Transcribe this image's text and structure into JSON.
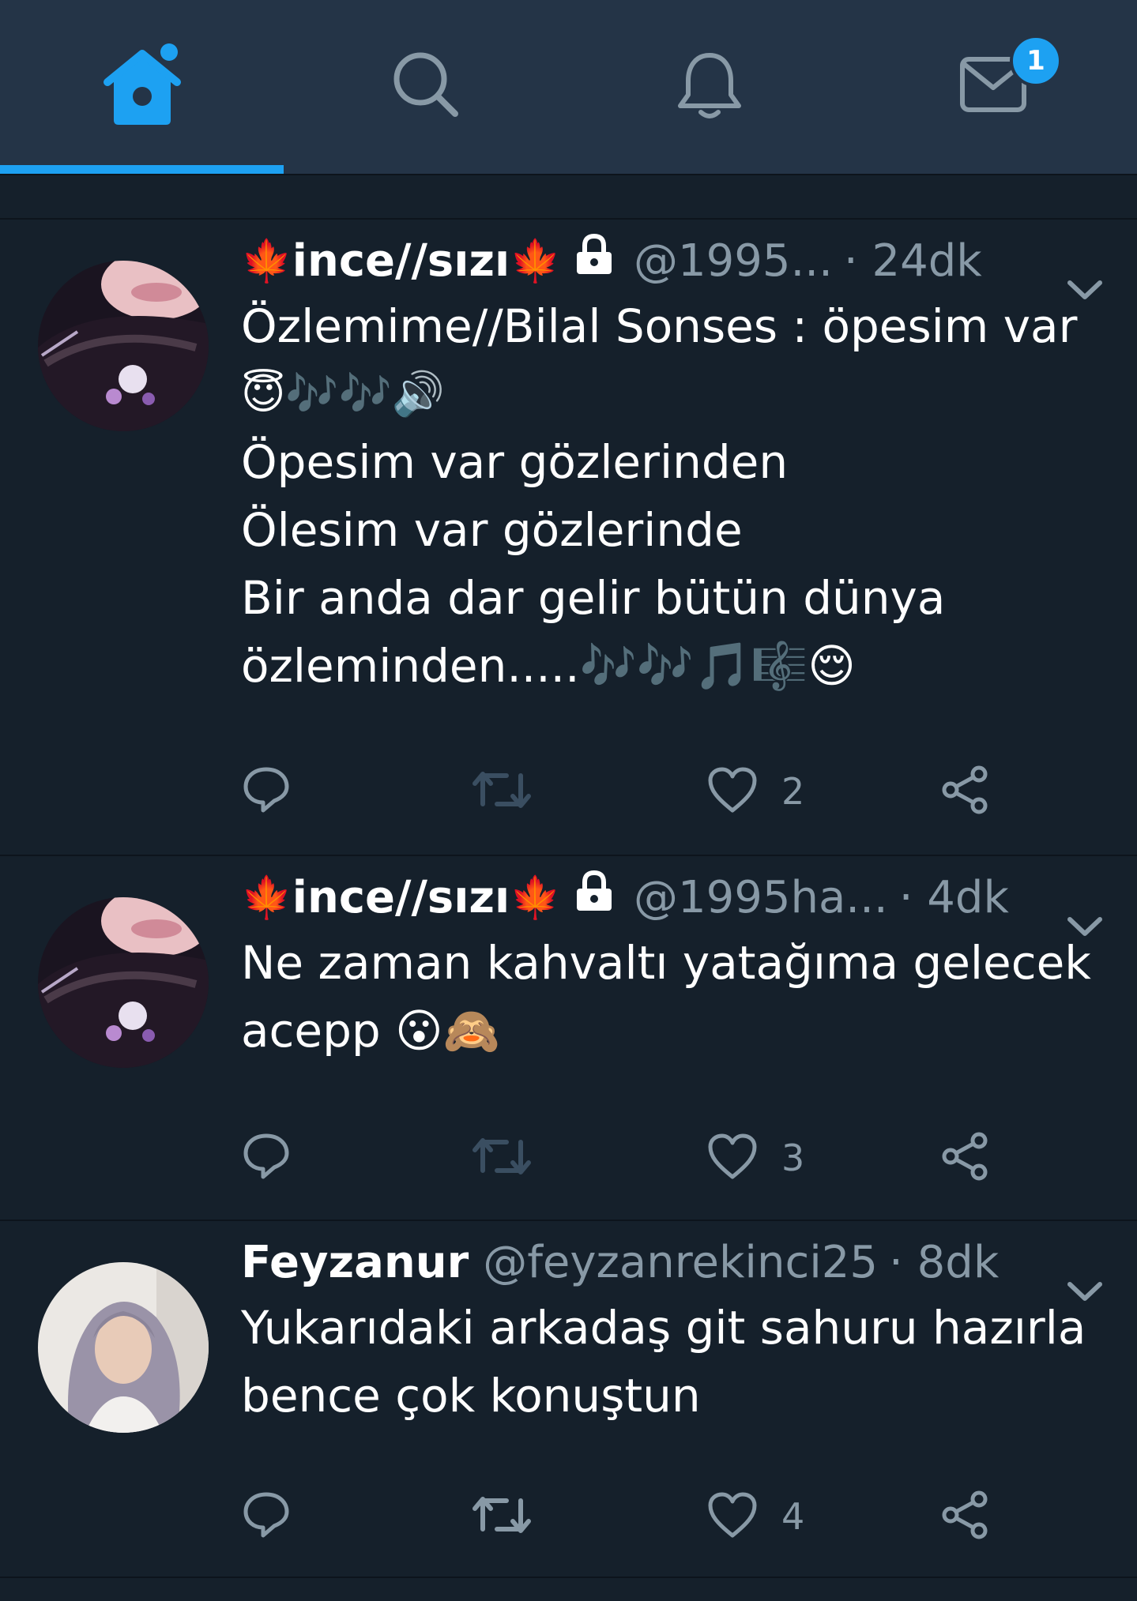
{
  "nav": {
    "tabs": [
      {
        "name": "home",
        "icon": "home-icon",
        "active": true
      },
      {
        "name": "search",
        "icon": "search-icon",
        "active": false
      },
      {
        "name": "notifications",
        "icon": "bell-icon",
        "active": false
      },
      {
        "name": "messages",
        "icon": "mail-icon",
        "active": false
      }
    ],
    "messages_badge": "1"
  },
  "colors": {
    "background": "#15202b",
    "topbar": "#243447",
    "accent": "#1da1f2",
    "secondary_text": "#8899a6"
  },
  "tweets": [
    {
      "leaf_left": "🍁",
      "name": "ince//sızı",
      "leaf_right": "🍁",
      "handle": "@1995...",
      "time": "· 24dk",
      "lines": [
        "Özlemime//Bilal Sonses : öpesim var",
        "😇🎶🎶🔊",
        "Öpesim var gözlerinden",
        "Ölesim var gözlerinde",
        "Bir anda dar gelir bütün dünya",
        "özleminden.....🎶🎶🎵🎼😌"
      ],
      "likes": "2"
    },
    {
      "leaf_left": "🍁",
      "name": "ince//sızı",
      "leaf_right": "🍁",
      "handle": "@1995ha...",
      "time": "· 4dk",
      "lines": [
        "Ne zaman kahvaltı yatağıma gelecek",
        "acepp 😮🙈"
      ],
      "likes": "3"
    },
    {
      "name": "Feyzanur",
      "handle": "@feyzanrekinci25",
      "time": "· 8dk",
      "lines": [
        "Yukarıdaki arkadaş git sahuru hazırla",
        "bence çok konuştun"
      ],
      "likes": "4"
    }
  ]
}
